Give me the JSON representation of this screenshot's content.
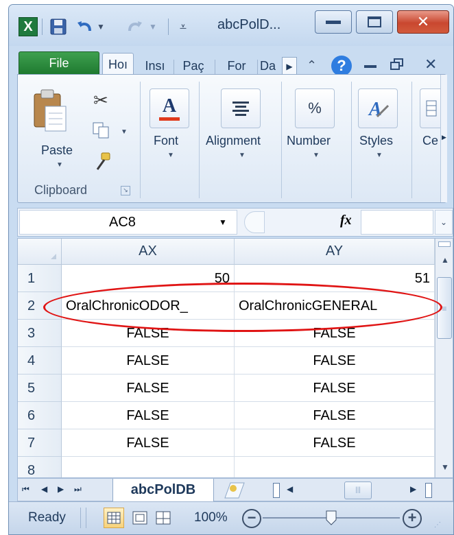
{
  "window": {
    "app_icon": "excel-icon",
    "title": "abcPolD..."
  },
  "tabs": [
    "File",
    "Hoı",
    "Insı",
    "Paç",
    "For",
    "Da"
  ],
  "ribbon": {
    "paste_label": "Paste",
    "clipboard_label": "Clipboard",
    "font_label": "Font",
    "alignment_label": "Alignment",
    "number_label": "Number",
    "number_icon_text": "%",
    "styles_label": "Styles",
    "cells_label": "Ce"
  },
  "formula_bar": {
    "name_box": "AC8",
    "fx": "fx"
  },
  "grid": {
    "columns": [
      "AX",
      "AY"
    ],
    "rows": [
      {
        "num": "1",
        "ax": "50",
        "ay": "51"
      },
      {
        "num": "2",
        "ax": "OralChronicODOR_",
        "ay": "OralChronicGENERAL"
      },
      {
        "num": "3",
        "ax": "FALSE",
        "ay": "FALSE"
      },
      {
        "num": "4",
        "ax": "FALSE",
        "ay": "FALSE"
      },
      {
        "num": "5",
        "ax": "FALSE",
        "ay": "FALSE"
      },
      {
        "num": "6",
        "ax": "FALSE",
        "ay": "FALSE"
      },
      {
        "num": "7",
        "ax": "FALSE",
        "ay": "FALSE"
      },
      {
        "num": "8",
        "ax": "",
        "ay": ""
      }
    ]
  },
  "sheet_tab": "abcPolDB",
  "status": {
    "ready": "Ready",
    "zoom": "100%"
  },
  "colors": {
    "annotation": "#e01414",
    "file_tab": "#2e8b3e"
  }
}
